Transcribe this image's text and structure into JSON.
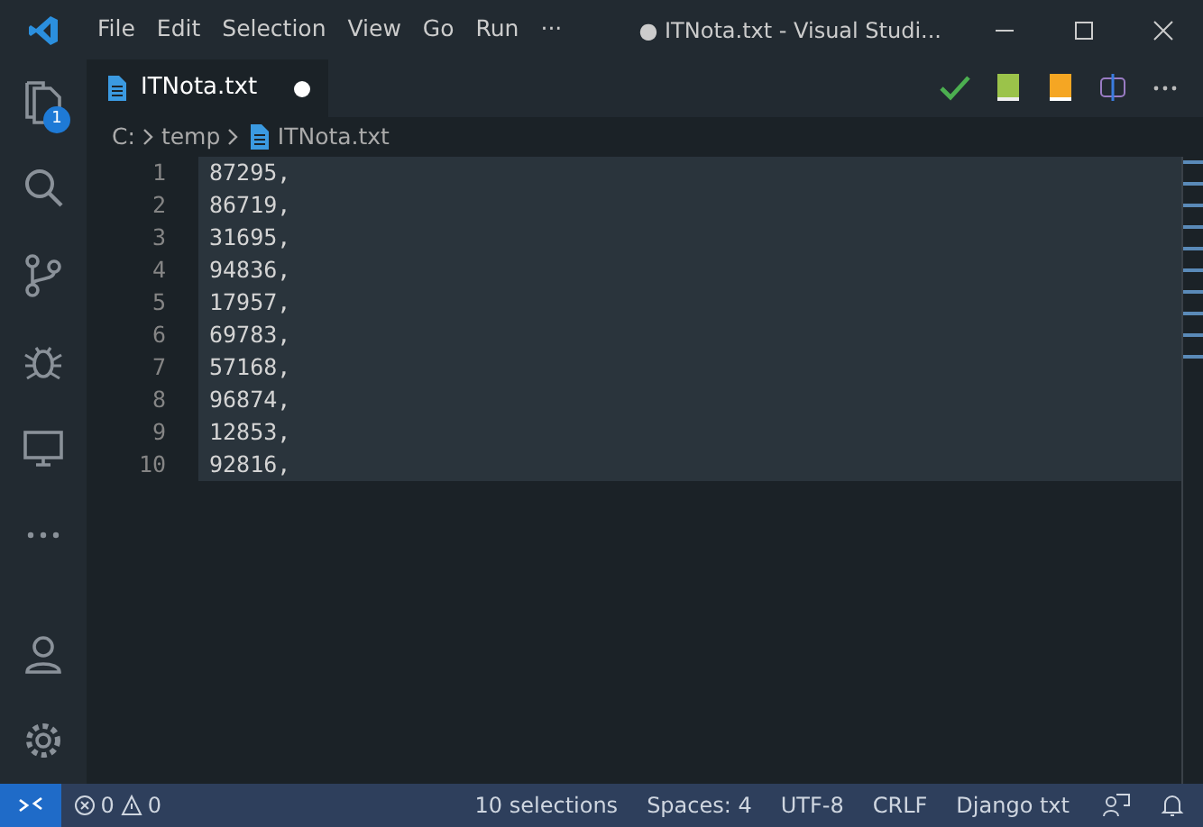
{
  "title_bar": {
    "menus": [
      "File",
      "Edit",
      "Selection",
      "View",
      "Go",
      "Run",
      "···"
    ],
    "title": "● ITNota.txt - Visual Studi..."
  },
  "activity_bar": {
    "explorer_badge": "1"
  },
  "tabs": [
    {
      "label": "ITNota.txt",
      "selected": true,
      "modified": true
    }
  ],
  "breadcrumb": [
    "C:",
    "temp",
    "ITNota.txt"
  ],
  "editor": {
    "lines": [
      {
        "number": "1",
        "text": "87295,",
        "selected": true
      },
      {
        "number": "2",
        "text": "86719,",
        "selected": true
      },
      {
        "number": "3",
        "text": "31695,",
        "selected": true
      },
      {
        "number": "4",
        "text": "94836,",
        "selected": true
      },
      {
        "number": "5",
        "text": "17957,",
        "selected": true
      },
      {
        "number": "6",
        "text": "69783,",
        "selected": true
      },
      {
        "number": "7",
        "text": "57168,",
        "selected": true
      },
      {
        "number": "8",
        "text": "96874,",
        "selected": true
      },
      {
        "number": "9",
        "text": "12853,",
        "selected": true
      },
      {
        "number": "10",
        "text": "92816,",
        "selected": true
      }
    ]
  },
  "status_bar": {
    "errors": "0",
    "warnings": "0",
    "items": [
      "10 selections",
      "Spaces: 4",
      "UTF-8",
      "CRLF",
      "Django txt"
    ]
  }
}
